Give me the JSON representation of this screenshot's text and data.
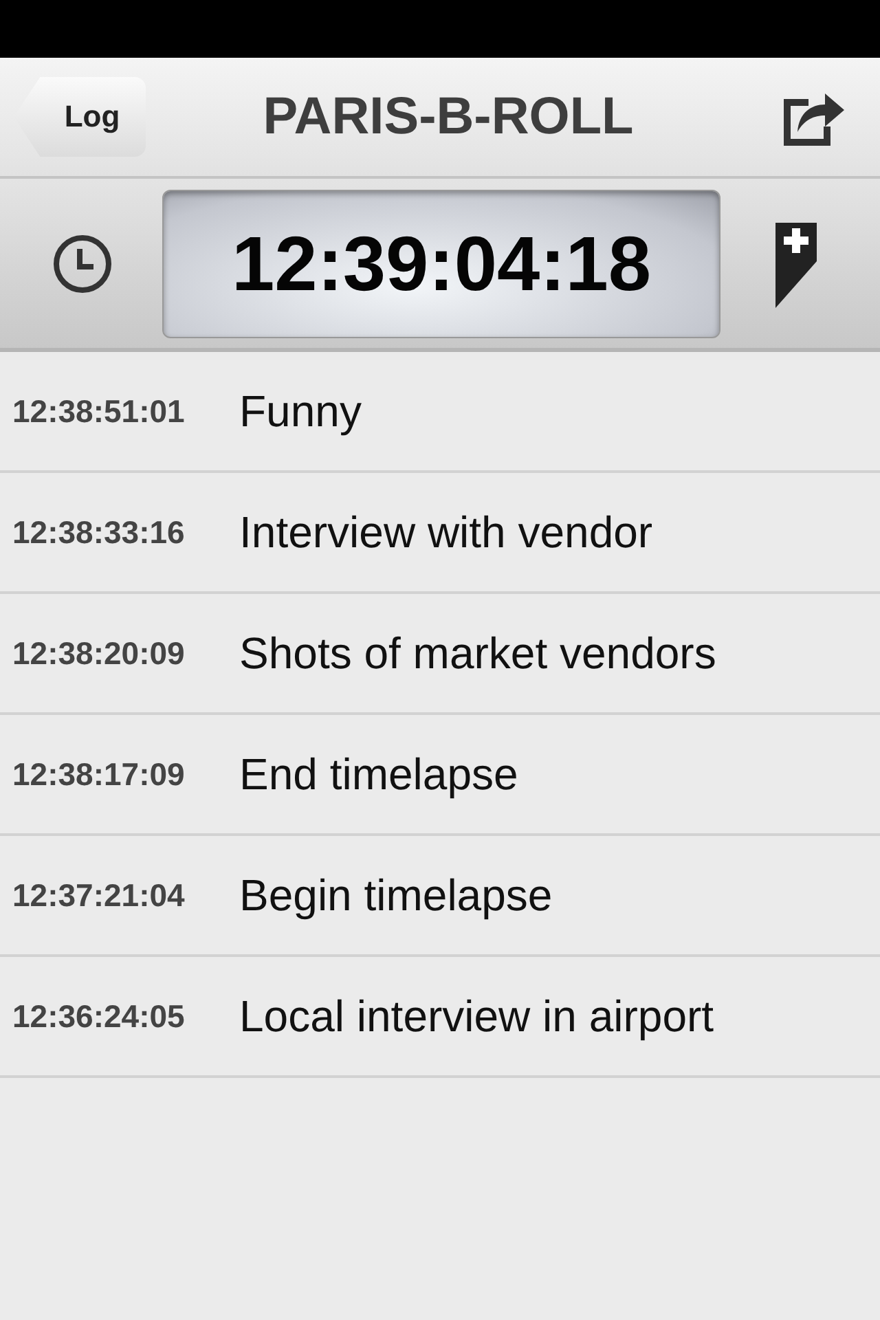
{
  "nav": {
    "back": "Log",
    "title": "PARIS-B-ROLL"
  },
  "timecode": "12:39:04:18",
  "entries": [
    {
      "time": "12:38:51:01",
      "note": "Funny"
    },
    {
      "time": "12:38:33:16",
      "note": "Interview with vendor"
    },
    {
      "time": "12:38:20:09",
      "note": "Shots of market vendors"
    },
    {
      "time": "12:38:17:09",
      "note": "End timelapse"
    },
    {
      "time": "12:37:21:04",
      "note": "Begin timelapse"
    },
    {
      "time": "12:36:24:05",
      "note": "Local interview in airport"
    }
  ]
}
